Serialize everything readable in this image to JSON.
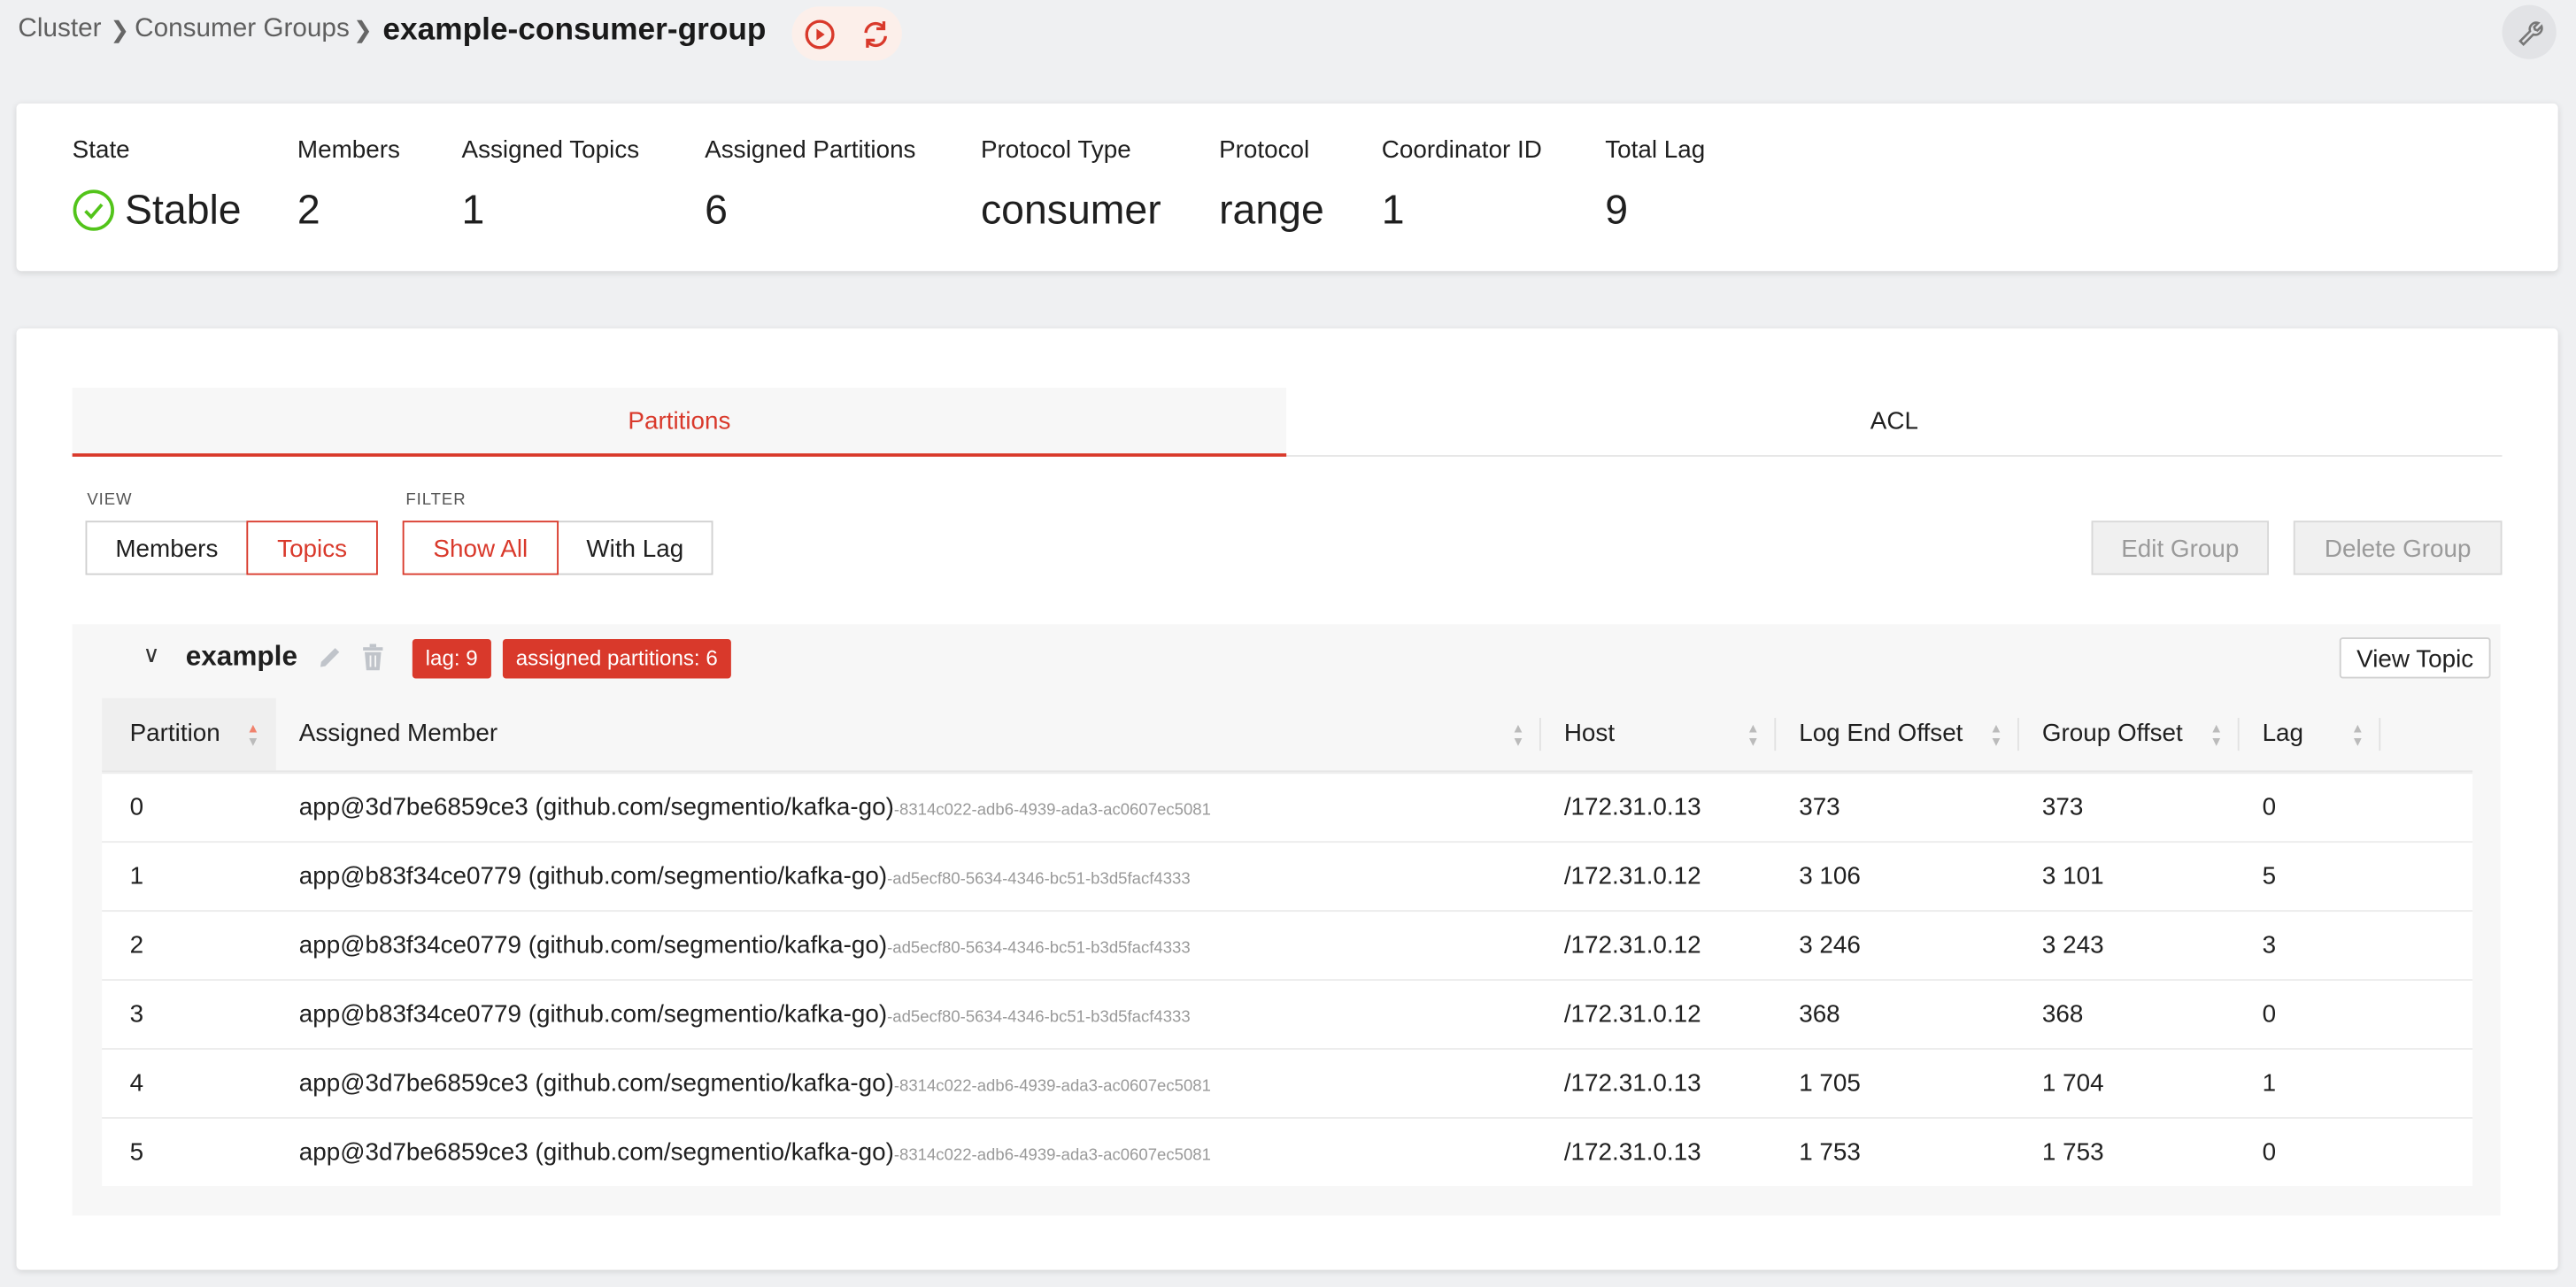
{
  "breadcrumb": {
    "items": [
      "Cluster",
      "Consumer Groups"
    ],
    "current": "example-consumer-group"
  },
  "header_actions": {
    "start_icon": "play-circle-icon",
    "refresh_icon": "refresh-icon",
    "settings_icon": "wrench-icon"
  },
  "stats": [
    {
      "label": "State",
      "value": "Stable"
    },
    {
      "label": "Members",
      "value": "2"
    },
    {
      "label": "Assigned Topics",
      "value": "1"
    },
    {
      "label": "Assigned Partitions",
      "value": "6"
    },
    {
      "label": "Protocol Type",
      "value": "consumer"
    },
    {
      "label": "Protocol",
      "value": "range"
    },
    {
      "label": "Coordinator ID",
      "value": "1"
    },
    {
      "label": "Total Lag",
      "value": "9"
    }
  ],
  "tabs": [
    {
      "label": "Partitions",
      "active": true
    },
    {
      "label": "ACL",
      "active": false
    }
  ],
  "view": {
    "label": "VIEW",
    "options": [
      "Members",
      "Topics"
    ],
    "selected": "Topics"
  },
  "filter": {
    "label": "FILTER",
    "options": [
      "Show All",
      "With Lag"
    ],
    "selected": "Show All"
  },
  "actions": {
    "edit": "Edit Group",
    "delete": "Delete Group"
  },
  "topic": {
    "name": "example",
    "lag_badge": "lag: 9",
    "partitions_badge": "assigned partitions: 6",
    "view_button": "View Topic"
  },
  "table": {
    "columns": [
      "Partition",
      "Assigned Member",
      "Host",
      "Log End Offset",
      "Group Offset",
      "Lag"
    ],
    "rows": [
      {
        "partition": "0",
        "member": "app@3d7be6859ce3 (github.com/segmentio/kafka-go)",
        "member_id": "-8314c022-adb6-4939-ada3-ac0607ec5081",
        "host": "/172.31.0.13",
        "log_end": "373",
        "group_offset": "373",
        "lag": "0"
      },
      {
        "partition": "1",
        "member": "app@b83f34ce0779 (github.com/segmentio/kafka-go)",
        "member_id": "-ad5ecf80-5634-4346-bc51-b3d5facf4333",
        "host": "/172.31.0.12",
        "log_end": "3 106",
        "group_offset": "3 101",
        "lag": "5"
      },
      {
        "partition": "2",
        "member": "app@b83f34ce0779 (github.com/segmentio/kafka-go)",
        "member_id": "-ad5ecf80-5634-4346-bc51-b3d5facf4333",
        "host": "/172.31.0.12",
        "log_end": "3 246",
        "group_offset": "3 243",
        "lag": "3"
      },
      {
        "partition": "3",
        "member": "app@b83f34ce0779 (github.com/segmentio/kafka-go)",
        "member_id": "-ad5ecf80-5634-4346-bc51-b3d5facf4333",
        "host": "/172.31.0.12",
        "log_end": "368",
        "group_offset": "368",
        "lag": "0"
      },
      {
        "partition": "4",
        "member": "app@3d7be6859ce3 (github.com/segmentio/kafka-go)",
        "member_id": "-8314c022-adb6-4939-ada3-ac0607ec5081",
        "host": "/172.31.0.13",
        "log_end": "1 705",
        "group_offset": "1 704",
        "lag": "1"
      },
      {
        "partition": "5",
        "member": "app@3d7be6859ce3 (github.com/segmentio/kafka-go)",
        "member_id": "-8314c022-adb6-4939-ada3-ac0607ec5081",
        "host": "/172.31.0.13",
        "log_end": "1 753",
        "group_offset": "1 753",
        "lag": "0"
      }
    ]
  },
  "colors": {
    "accent": "#d9392b",
    "success": "#52c41a",
    "background": "#eff0f2"
  }
}
